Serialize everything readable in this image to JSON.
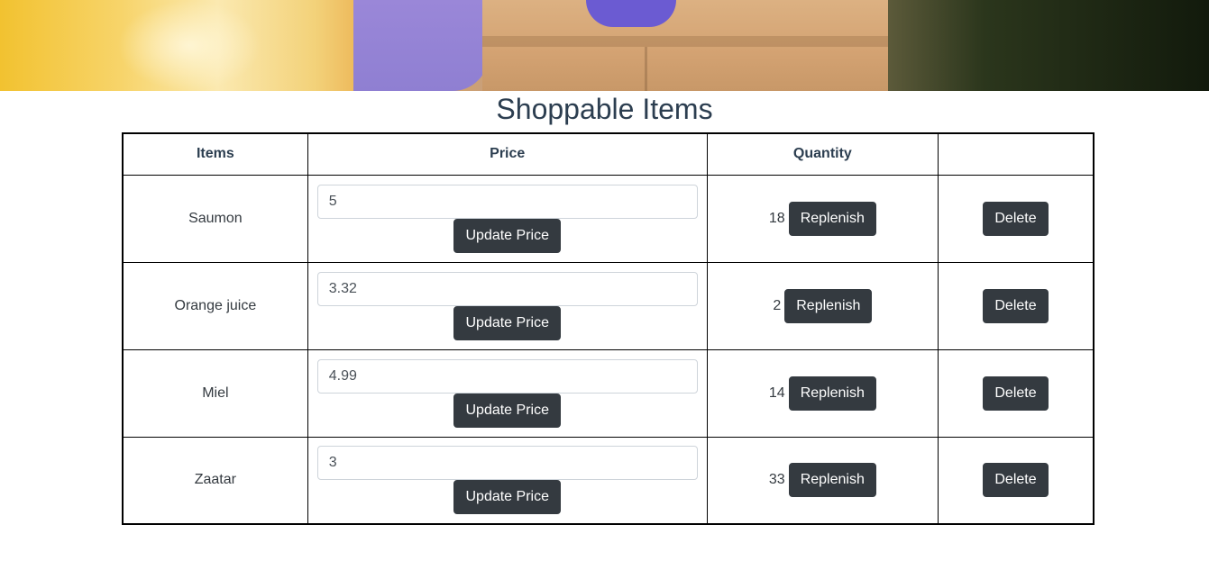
{
  "page": {
    "title": "Shoppable Items"
  },
  "table": {
    "headers": [
      "Items",
      "Price",
      "Quantity",
      ""
    ],
    "update_label": "Update Price",
    "replenish_label": "Replenish",
    "delete_label": "Delete",
    "rows": [
      {
        "item": "Saumon",
        "price": "5",
        "quantity": "18"
      },
      {
        "item": "Orange juice",
        "price": "3.32",
        "quantity": "2"
      },
      {
        "item": "Miel",
        "price": "4.99",
        "quantity": "14"
      },
      {
        "item": "Zaatar",
        "price": "3",
        "quantity": "33"
      }
    ]
  },
  "colors": {
    "button": "#343a40",
    "title": "#2c3e50",
    "border": "#000000"
  }
}
